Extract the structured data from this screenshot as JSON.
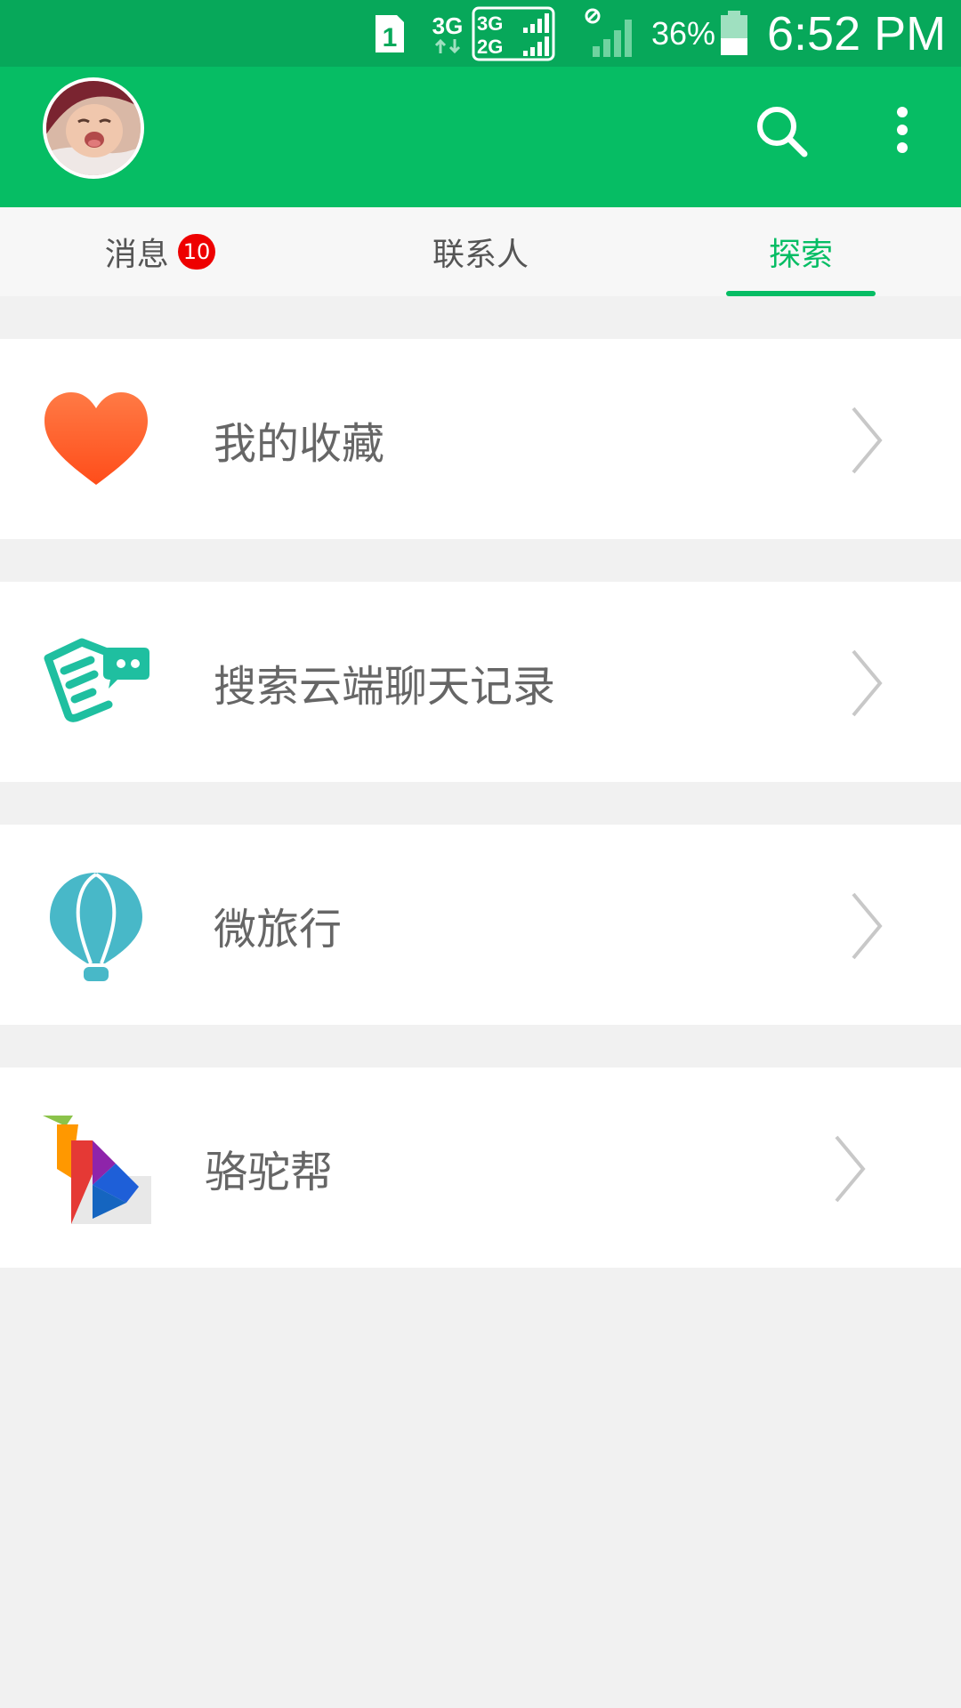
{
  "status_bar": {
    "sim_slot": "1",
    "network_type": "3G",
    "network_badge_top": "3G",
    "network_badge_bottom": "2G",
    "battery_percent": "36%",
    "time": "6:52 PM"
  },
  "app_bar": {
    "avatar_icon": "baby-avatar",
    "search_icon": "search-icon",
    "menu_icon": "more-vertical-icon"
  },
  "tabs": [
    {
      "label": "消息",
      "badge": "10",
      "active": false
    },
    {
      "label": "联系人",
      "active": false
    },
    {
      "label": "探索",
      "active": true
    }
  ],
  "explore_items": [
    {
      "label": "我的收藏",
      "icon": "heart-icon"
    },
    {
      "label": "搜索云端聊天记录",
      "icon": "chat-notes-icon"
    },
    {
      "label": "微旅行",
      "icon": "hot-air-balloon-icon"
    },
    {
      "label": "骆驼帮",
      "icon": "origami-bird-icon"
    }
  ],
  "colors": {
    "status_bar": "#07a85a",
    "app_bar": "#06bd64",
    "accent": "#06bd64",
    "badge": "#ee0000",
    "background": "#f1f1f1"
  }
}
